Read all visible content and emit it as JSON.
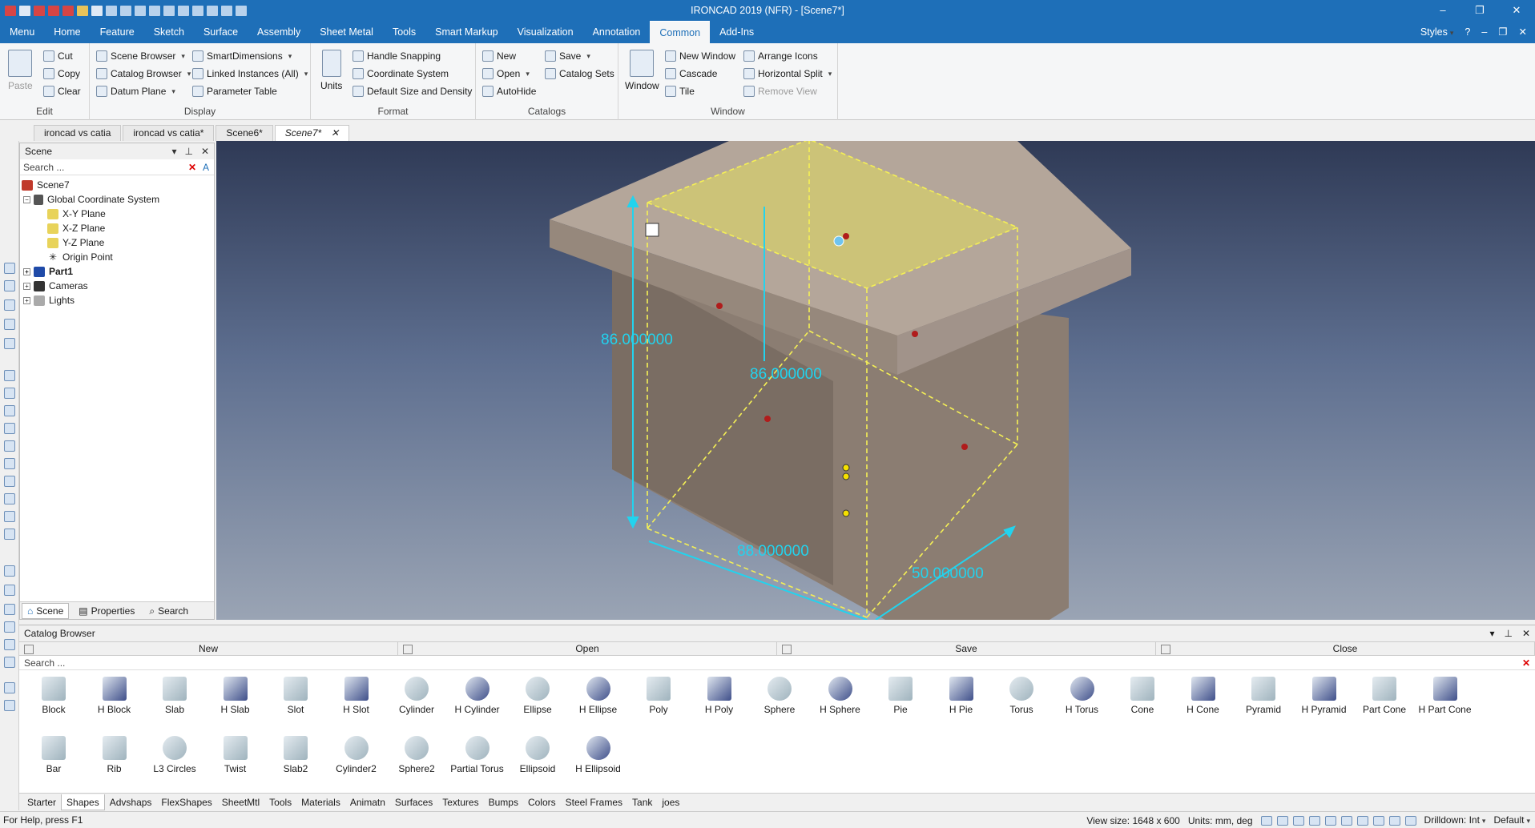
{
  "window": {
    "title": "IRONCAD 2019 (NFR) - [Scene7*]",
    "controls": [
      "–",
      "❐",
      "✕"
    ]
  },
  "ribbon_tabs": [
    "Menu",
    "Home",
    "Feature",
    "Sketch",
    "Surface",
    "Assembly",
    "Sheet Metal",
    "Tools",
    "Smart Markup",
    "Visualization",
    "Annotation",
    "Common",
    "Add-Ins"
  ],
  "active_ribbon_tab": "Common",
  "styles_label": "Styles",
  "groups": {
    "edit": {
      "label": "Edit",
      "paste": "Paste",
      "cut": "Cut",
      "copy": "Copy",
      "clear": "Clear"
    },
    "display": {
      "label": "Display",
      "scene_browser": "Scene Browser",
      "catalog_browser": "Catalog Browser",
      "datum_plane": "Datum Plane",
      "smart_dimensions": "SmartDimensions",
      "linked_instances": "Linked Instances (All)",
      "parameter_table": "Parameter Table"
    },
    "format": {
      "label": "Format",
      "units": "Units",
      "handle_snapping": "Handle Snapping",
      "coordinate_system": "Coordinate System",
      "default_size": "Default Size and Density"
    },
    "catalogs": {
      "label": "Catalogs",
      "new": "New",
      "open": "Open",
      "autohide": "AutoHide",
      "save": "Save",
      "catalog_sets": "Catalog Sets"
    },
    "window": {
      "label": "Window",
      "window": "Window",
      "new_window": "New Window",
      "cascade": "Cascade",
      "tile": "Tile",
      "arrange_icons": "Arrange Icons",
      "horizontal_split": "Horizontal Split",
      "remove_view": "Remove View"
    }
  },
  "doc_tabs": [
    "ironcad vs catia",
    "ironcad vs catia*",
    "Scene6*",
    "Scene7*"
  ],
  "active_doc_tab": "Scene7*",
  "scene_panel": {
    "title": "Scene",
    "search_placeholder": "Search ...",
    "tree": [
      {
        "label": "Scene7",
        "level": 0,
        "icon": "scene-icon"
      },
      {
        "label": "Global Coordinate System",
        "level": 1,
        "icon": "axis-icon",
        "expander": "−"
      },
      {
        "label": "X-Y Plane",
        "level": 2,
        "icon": "plane-icon"
      },
      {
        "label": "X-Z Plane",
        "level": 2,
        "icon": "plane-icon"
      },
      {
        "label": "Y-Z Plane",
        "level": 2,
        "icon": "plane-icon"
      },
      {
        "label": "Origin Point",
        "level": 2,
        "icon": "origin-icon"
      },
      {
        "label": "Part1",
        "level": 1,
        "icon": "part-icon",
        "expander": "+",
        "bold": true
      },
      {
        "label": "Cameras",
        "level": 1,
        "icon": "camera-icon",
        "expander": "+"
      },
      {
        "label": "Lights",
        "level": 1,
        "icon": "light-icon",
        "expander": "+"
      }
    ],
    "footer_tabs": [
      "Scene",
      "Properties",
      "Search"
    ]
  },
  "viewport": {
    "dimensions": [
      "86.000000",
      "86.000000",
      "88.000000",
      "50.000000"
    ]
  },
  "catalog_browser": {
    "title": "Catalog Browser",
    "buttons": [
      "New",
      "Open",
      "Save",
      "Close"
    ],
    "search_placeholder": "Search ...",
    "shapes_row1": [
      "Block",
      "H Block",
      "Slab",
      "H Slab",
      "Slot",
      "H Slot",
      "Cylinder",
      "H Cylinder",
      "Ellipse",
      "H Ellipse",
      "Poly",
      "H Poly",
      "Sphere",
      "H Sphere",
      "Pie",
      "H Pie",
      "Torus",
      "H Torus",
      "Cone",
      "H Cone",
      "Pyramid",
      "H Pyramid",
      "Part Cone",
      "H Part Cone"
    ],
    "shapes_row2": [
      "Bar",
      "Rib",
      "L3 Circles",
      "Twist",
      "Slab2",
      "Cylinder2",
      "Sphere2",
      "Partial Torus",
      "Ellipsoid",
      "H Ellipsoid"
    ],
    "tabs": [
      "Starter",
      "Shapes",
      "Advshaps",
      "FlexShapes",
      "SheetMtl",
      "Tools",
      "Materials",
      "Animatn",
      "Surfaces",
      "Textures",
      "Bumps",
      "Colors",
      "Steel Frames",
      "Tank",
      "joes"
    ],
    "active_tab": "Shapes"
  },
  "status": {
    "help": "For Help, press F1",
    "view_size": "View size: 1648 x 600",
    "units": "Units: mm, deg",
    "drilldown": "Drilldown: Int",
    "default": "Default"
  },
  "colors": {
    "accent": "#1e6fb8",
    "dimension": "#22d3ee",
    "selection": "#f5f055"
  }
}
